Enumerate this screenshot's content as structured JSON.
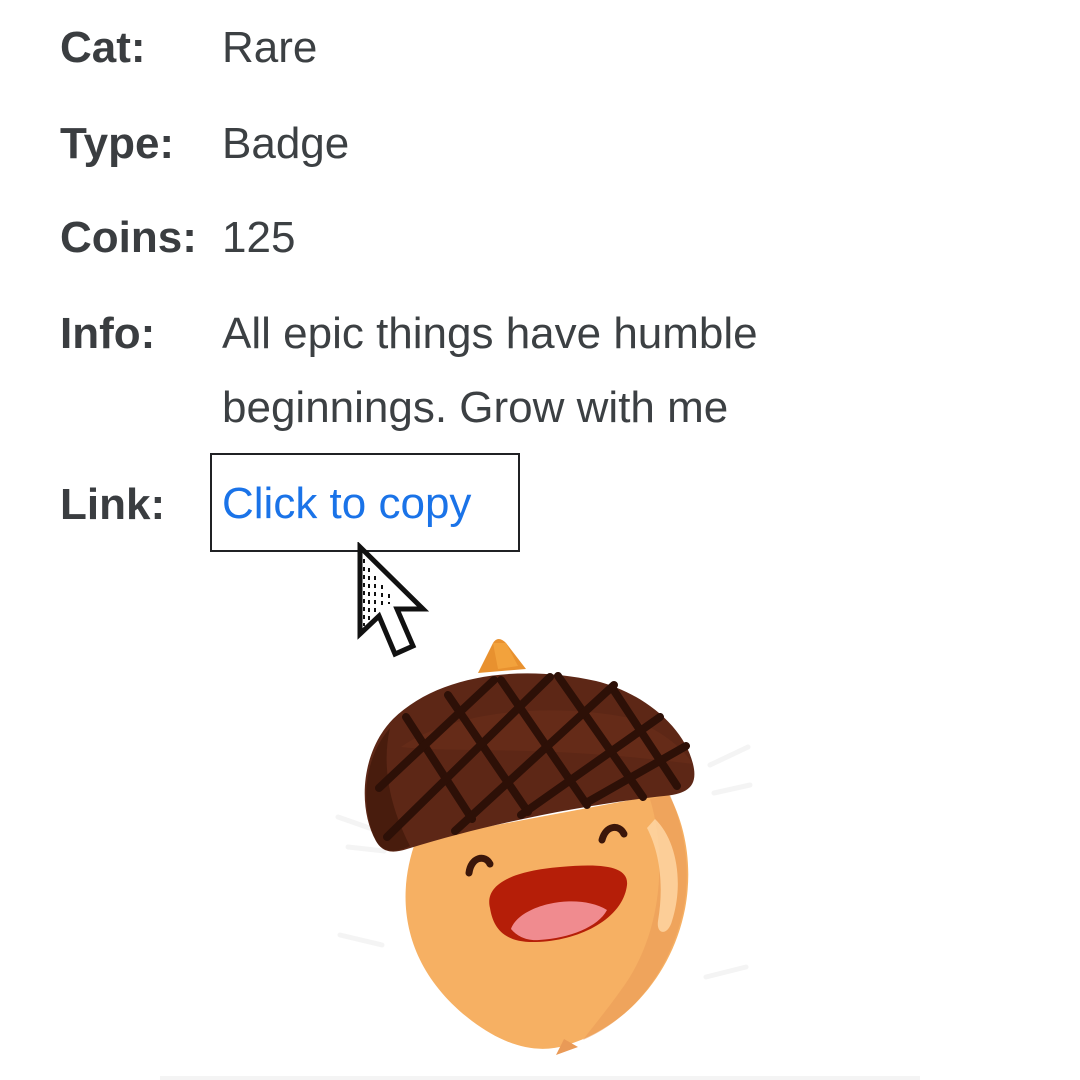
{
  "details": {
    "cat": {
      "label": "Cat:",
      "value": "Rare"
    },
    "type": {
      "label": "Type:",
      "value": "Badge"
    },
    "coins": {
      "label": "Coins:",
      "value": "125"
    },
    "info": {
      "label": "Info:",
      "value": "All epic things have humble beginnings. Grow with me"
    },
    "link": {
      "label": "Link:",
      "value": "Click to copy"
    }
  },
  "icons": {
    "cursor": "mouse-pointer-icon",
    "sticker": "acorn-character-icon"
  },
  "colors": {
    "text": "#3c4043",
    "link": "#1a73e8",
    "cap": "#5b2414",
    "nut": "#f5a460"
  }
}
